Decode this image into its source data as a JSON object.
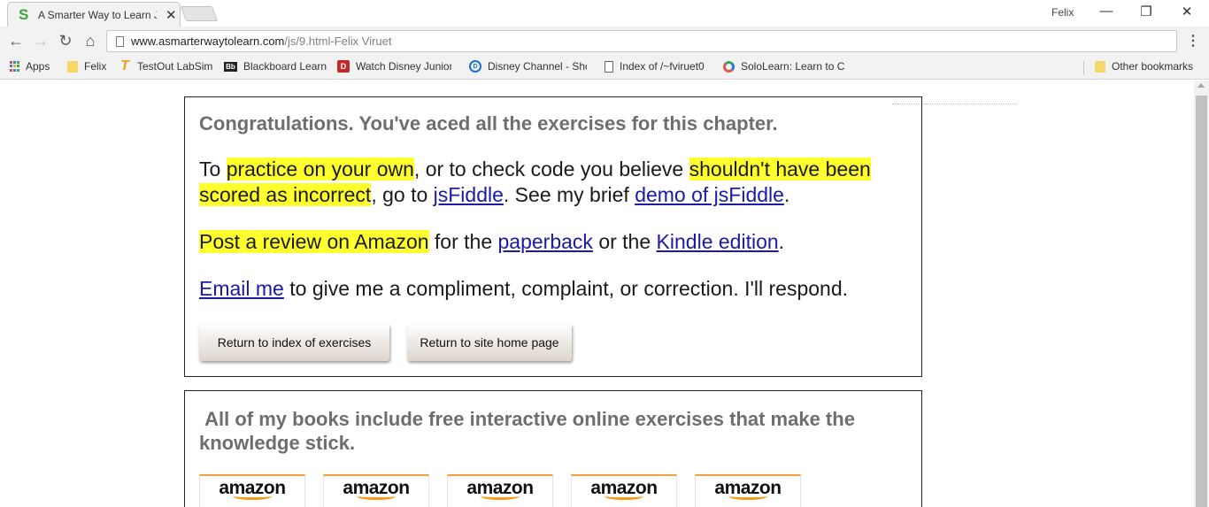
{
  "browser": {
    "tab_title": "A Smarter Way to Learn J",
    "tab_favicon": "S",
    "profile_name": "Felix",
    "url_host": "www.asmarterwaytolearn.com",
    "url_path": "/js/9.html-Felix Viruet",
    "bookmarks": [
      {
        "label": "Apps",
        "icon": "apps-grid-icon"
      },
      {
        "label": "Felix",
        "icon": "folder-icon"
      },
      {
        "label": "TestOut LabSim",
        "icon": "testout-icon"
      },
      {
        "label": "Blackboard Learn",
        "icon": "blackboard-icon"
      },
      {
        "label": "Watch Disney Junior",
        "icon": "disney-junior-icon"
      },
      {
        "label": "Disney Channel - Sho",
        "icon": "disney-channel-icon"
      },
      {
        "label": "Index of /~fviruet0",
        "icon": "page-icon"
      },
      {
        "label": "SoloLearn: Learn to C",
        "icon": "sololearn-icon"
      }
    ],
    "other_bookmarks": "Other bookmarks"
  },
  "content": {
    "congrats": "Congratulations. You've aced all the exercises for this chapter.",
    "p1": {
      "t1": "To ",
      "h1": "practice on your own",
      "t2": ", or to check code you believe ",
      "h2": "shouldn't have been scored as incorrect",
      "t3": ", go to ",
      "l1": "jsFiddle",
      "t4": ". See my brief ",
      "l2": "demo of jsFiddle",
      "t5": "."
    },
    "p2": {
      "h1": "Post a review on Amazon",
      "t1": " for the ",
      "l1": "paperback",
      "t2": " or the ",
      "l2": "Kindle edition",
      "t3": "."
    },
    "p3": {
      "l1": "Email me",
      "t1": " to give me a compliment, complaint, or correction. I'll respond."
    },
    "buttons": {
      "index": "Return to index of exercises",
      "home": "Return to site home page"
    },
    "books_title": " All of my books include free interactive online exercises that make the knowledge stick.",
    "book_logo": "amazon",
    "book_count": 5
  }
}
